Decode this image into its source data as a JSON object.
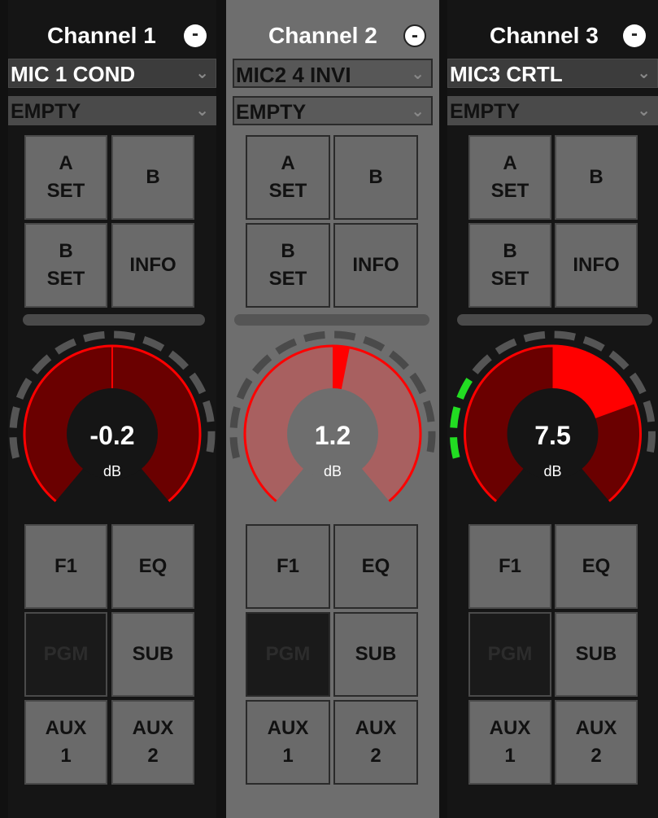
{
  "channels": [
    {
      "title": "Channel 1",
      "minus_label": "-",
      "mic_select": "MIC 1 COND",
      "slot_select": "EMPTY",
      "buttons": {
        "a_set": "A\nSET",
        "b": "B",
        "b_set": "B\nSET",
        "info": "INFO",
        "f1": "F1",
        "eq": "EQ",
        "pgm": "PGM",
        "sub": "SUB",
        "aux1": "AUX\n1",
        "aux2": "AUX\n2"
      },
      "gain": {
        "value": "-0.2",
        "unit": "dB",
        "level": 0.0,
        "meter_segments_lit": 0
      }
    },
    {
      "title": "Channel 2",
      "minus_label": "-",
      "mic_select": "MIC2 4 INVI",
      "slot_select": "EMPTY",
      "buttons": {
        "a_set": "A\nSET",
        "b": "B",
        "b_set": "B\nSET",
        "info": "INFO",
        "f1": "F1",
        "eq": "EQ",
        "pgm": "PGM",
        "sub": "SUB",
        "aux1": "AUX\n1",
        "aux2": "AUX\n2"
      },
      "gain": {
        "value": "1.2",
        "unit": "dB",
        "level": 0.04,
        "meter_segments_lit": 0
      }
    },
    {
      "title": "Channel 3",
      "minus_label": "-",
      "mic_select": "MIC3 CRTL",
      "slot_select": "EMPTY",
      "buttons": {
        "a_set": "A\nSET",
        "b": "B",
        "b_set": "B\nSET",
        "info": "INFO",
        "f1": "F1",
        "eq": "EQ",
        "pgm": "PGM",
        "sub": "SUB",
        "aux1": "AUX\n1",
        "aux2": "AUX\n2"
      },
      "gain": {
        "value": "7.5",
        "unit": "dB",
        "level": 0.25,
        "meter_segments_lit": 3
      }
    }
  ],
  "colors": {
    "gain_arc": "#ff0000",
    "gain_fill_dark": "#6a0000",
    "gain_fill_selected": "#a86060",
    "meter_lit": "#22dd22",
    "meter_off": "#555555"
  },
  "icons": {
    "dropdown": "chevron-down-icon"
  }
}
